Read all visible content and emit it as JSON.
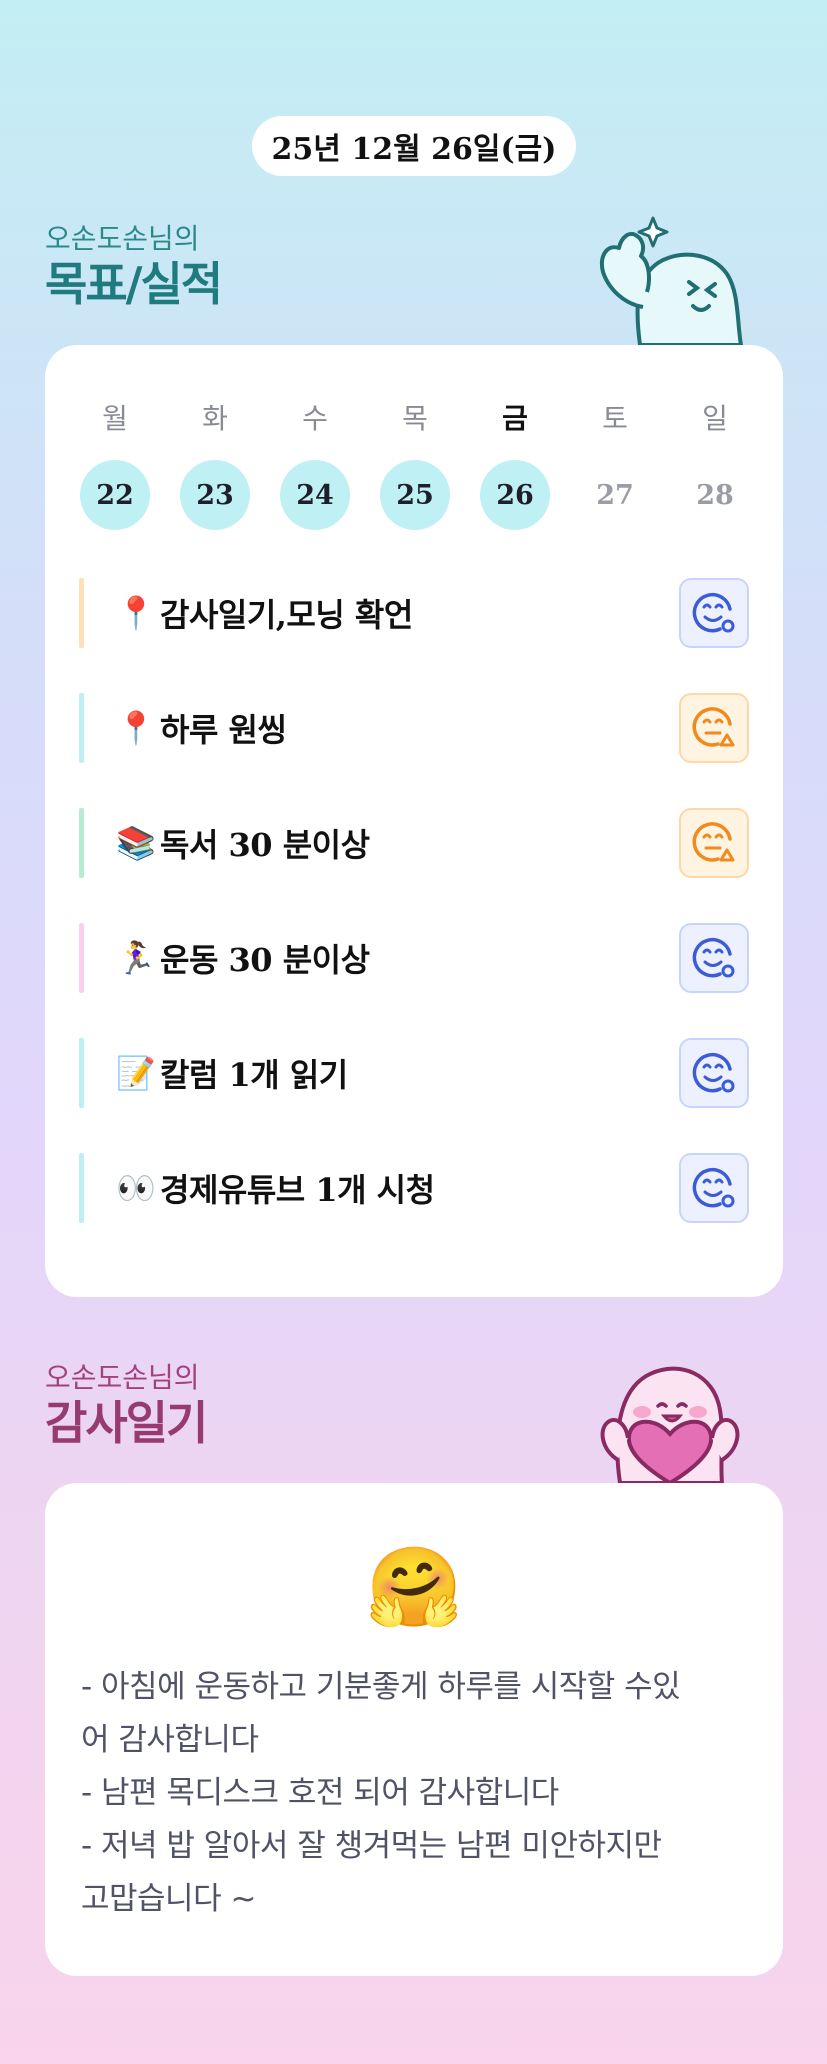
{
  "header": {
    "date": "25년 12월 26일(금)"
  },
  "goals_section": {
    "subtitle": "오손도손님의",
    "title": "목표/실적",
    "weekdays": [
      "월",
      "화",
      "수",
      "목",
      "금",
      "토",
      "일"
    ],
    "days": [
      "22",
      "23",
      "24",
      "25",
      "26",
      "27",
      "28"
    ],
    "goals": [
      {
        "emoji": "📍",
        "text": "감사일기,모닝 확언",
        "bar_color": "#fde0b7",
        "status": "done-blue"
      },
      {
        "emoji": "📍",
        "text": "하루 원씽",
        "bar_color": "#bfeff3",
        "status": "warn-orange"
      },
      {
        "emoji": "📚",
        "text": "독서 30 분이상",
        "bar_color": "#b7ecd2",
        "status": "warn-orange"
      },
      {
        "emoji": "🏃‍♀️",
        "text": "운동 30 분이상",
        "bar_color": "#fbd0ec",
        "status": "done-blue"
      },
      {
        "emoji": "📝",
        "text": "칼럼 1개 읽기",
        "bar_color": "#bfeff3",
        "status": "done-blue"
      },
      {
        "emoji": "👀",
        "text": "경제유튜브 1개 시청",
        "bar_color": "#bfeff3",
        "status": "done-blue"
      }
    ]
  },
  "thanks_section": {
    "subtitle": "오손도손님의",
    "title": "감사일기",
    "emoji": "🤗",
    "lines": [
      "- 아침에 운동하고 기분좋게 하루를 시작할 수있",
      "어 감사합니다",
      "- 남편 목디스크 호전 되어 감사합니다",
      "- 저녁 밥 알아서 잘 챙겨먹는 남편 미안하지만",
      "고맙습니다 ~"
    ]
  },
  "colors": {
    "accent_teal": "#1f7b7d",
    "accent_plum": "#973a72",
    "face_blue": "#3b5bd9",
    "face_orange": "#f08a1c"
  }
}
